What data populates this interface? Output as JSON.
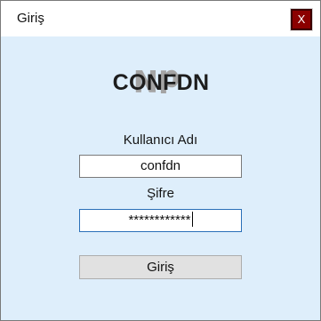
{
  "window": {
    "title": "Giriş",
    "close_label": "X"
  },
  "logo": {
    "text": "CONFDN"
  },
  "form": {
    "username_label": "Kullanıcı Adı",
    "username_value": "confdn",
    "password_label": "Şifre",
    "password_value": "************",
    "login_label": "Giriş"
  },
  "colors": {
    "client_background": "#deeefb",
    "close_button": "#8b0000",
    "focus_border": "#2a6fb8"
  },
  "icons": {
    "logo_mark": "cdn-monogram-icon"
  }
}
